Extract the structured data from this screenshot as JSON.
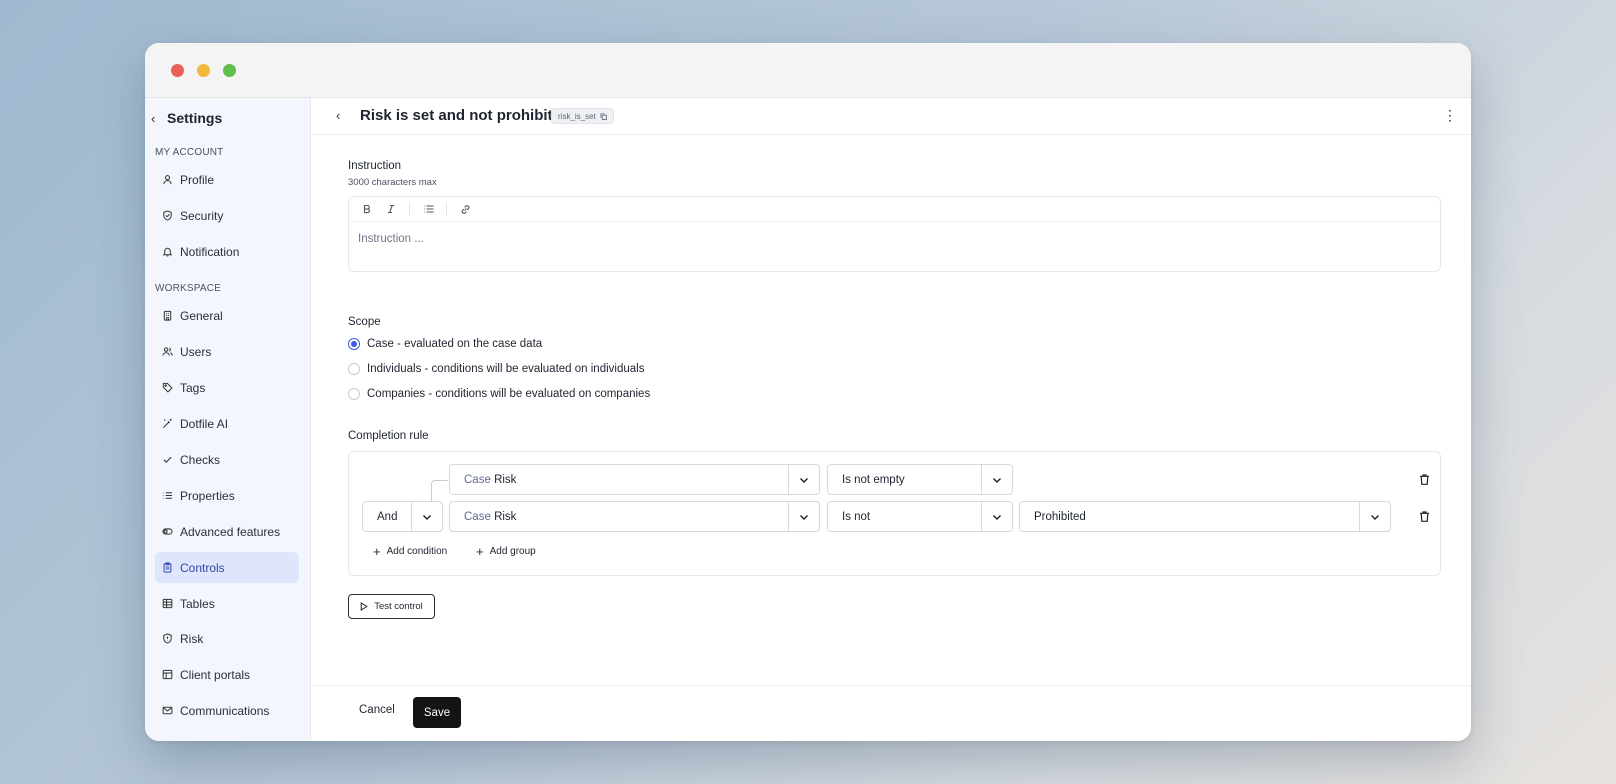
{
  "sidebar": {
    "back_label": "Settings",
    "sections": {
      "account": "MY ACCOUNT",
      "workspace": "WORKSPACE"
    },
    "account_items": [
      {
        "label": "Profile",
        "icon": "user-icon"
      },
      {
        "label": "Security",
        "icon": "shield-check-icon"
      },
      {
        "label": "Notification",
        "icon": "bell-icon"
      }
    ],
    "workspace_items": [
      {
        "label": "General",
        "icon": "building-icon"
      },
      {
        "label": "Users",
        "icon": "users-icon"
      },
      {
        "label": "Tags",
        "icon": "tag-icon"
      },
      {
        "label": "Dotfile AI",
        "icon": "magic-wand-icon"
      },
      {
        "label": "Checks",
        "icon": "check-icon"
      },
      {
        "label": "Properties",
        "icon": "list-icon"
      },
      {
        "label": "Advanced features",
        "icon": "toggle-icon"
      },
      {
        "label": "Controls",
        "icon": "clipboard-icon",
        "active": true
      },
      {
        "label": "Tables",
        "icon": "table-icon"
      },
      {
        "label": "Risk",
        "icon": "shield-icon"
      },
      {
        "label": "Client portals",
        "icon": "layout-icon"
      },
      {
        "label": "Communications",
        "icon": "mail-icon"
      }
    ]
  },
  "header": {
    "title": "Risk is set and not prohibited",
    "code": "risk_is_set"
  },
  "instruction": {
    "label": "Instruction",
    "hint": "3000 characters max",
    "placeholder": "Instruction ..."
  },
  "scope": {
    "label": "Scope",
    "options": [
      {
        "label": "Case - evaluated on the case data",
        "checked": true
      },
      {
        "label": "Individuals - conditions will be evaluated on individuals",
        "checked": false
      },
      {
        "label": "Companies - conditions will be evaluated on companies",
        "checked": false
      }
    ]
  },
  "completion_rule": {
    "label": "Completion rule",
    "conditions": [
      {
        "field_prefix": "Case",
        "field": "Risk",
        "operator": "Is not empty"
      },
      {
        "logic": "And",
        "field_prefix": "Case",
        "field": "Risk",
        "operator": "Is not",
        "value": "Prohibited"
      }
    ],
    "add_condition": "Add condition",
    "add_group": "Add group"
  },
  "test_button": "Test control",
  "footer": {
    "cancel": "Cancel",
    "save": "Save"
  },
  "colors": {
    "accent": "#3d5be0",
    "active_nav_bg": "#dfe5fb",
    "save_bg": "#141414"
  }
}
